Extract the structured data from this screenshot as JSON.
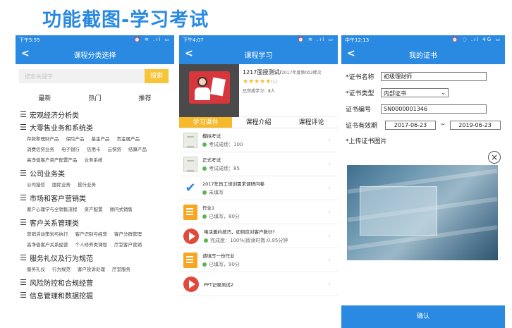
{
  "page_title": "功能截图-学习考试",
  "colors": {
    "primary": "#2a8ae2",
    "accent": "#f6b92b"
  },
  "phone1": {
    "status_time": "下午5:55",
    "status_icons": "⏰ ≋ .ıl ▭",
    "title": "课程分类选择",
    "search_placeholder": "搜索关键字",
    "search_button": "搜索",
    "tabs": [
      "最新",
      "热门",
      "推荐"
    ],
    "categories": [
      {
        "name": "宏观经济分析类",
        "subs": []
      },
      {
        "name": "大零售业务和系统类",
        "subs": [
          "存款和理财产品",
          "保险产品",
          "基金产品",
          "贵金属产品",
          "消费信贷业务",
          "电子银行",
          "信用卡",
          "云快贷",
          "结算产品",
          "高净值客户资产配置产品",
          "业务系统"
        ]
      },
      {
        "name": "公司业务类",
        "subs": [
          "公司授信",
          "国际业务",
          "投行业务"
        ]
      },
      {
        "name": "市场和客户营销类",
        "subs": [
          "客户心理学与全销售流程",
          "资产配置",
          "顾问式销售"
        ]
      },
      {
        "name": "客户关系管理类",
        "subs": [
          "营销活动策划与执行",
          "客户识别与经营",
          "客户分群管理",
          "高净值客户关系经营",
          "个人修养类课程",
          "厅堂客户营销"
        ]
      },
      {
        "name": "服务礼仪及行为规范",
        "subs": [
          "服务礼仪",
          "行为规范",
          "客户投诉处理",
          "厅堂服务"
        ]
      },
      {
        "name": "风险防控和合规经营",
        "subs": []
      },
      {
        "name": "信息管理和数据挖掘",
        "subs": []
      }
    ]
  },
  "phone2": {
    "status_time": "下午4:07",
    "status_icons": "⏰ ≋ .ıl ▭",
    "title": "课程学习",
    "course_title": "1217面授测试/",
    "course_title_small": "2017年度第002稀次",
    "stars": "★★★★★",
    "rating_count": "(1)",
    "learned": "已完成学习：8人",
    "tabs": [
      "学习课件",
      "课程介绍",
      "课程评论"
    ],
    "lessons": [
      {
        "icon": "doc-icon",
        "title": "模拟考试",
        "sub": "考试成绩：100"
      },
      {
        "icon": "doc-icon",
        "title": "正式考试",
        "sub": "考试成绩：85"
      },
      {
        "icon": "checklist-icon",
        "title": "2017年员工培训需求调研问卷",
        "sub": "未填写"
      },
      {
        "icon": "assignment-icon",
        "title": "作业1",
        "sub": "已填写，80分"
      },
      {
        "icon": "video-icon",
        "title": "电话邀约技巧，如何应对客户数衍?",
        "sub": "完成度：100%|阅读时数:0.95分钟"
      },
      {
        "icon": "assignment-icon",
        "title": "请填写一份作业",
        "sub": "已填写，90分"
      },
      {
        "icon": "video-icon",
        "title": "PPT记录测试2",
        "sub": ""
      }
    ]
  },
  "phone3": {
    "status_time": "中午12:13",
    "status_icons": "⏰ ◌ .ıl 4G ▭",
    "title": "我的证书",
    "fields": {
      "name_label": "*证书名称",
      "name_value": "初级理财师",
      "type_label": "*证书类型",
      "type_value": "内部证书",
      "number_label": "证书编号",
      "number_value": "SN0000001346",
      "valid_label": "证书有效期",
      "valid_from": "2017-06-23",
      "valid_to": "2019-06-23",
      "tilde": "~"
    },
    "upload_label": "*上传证书图片",
    "confirm": "确认"
  }
}
